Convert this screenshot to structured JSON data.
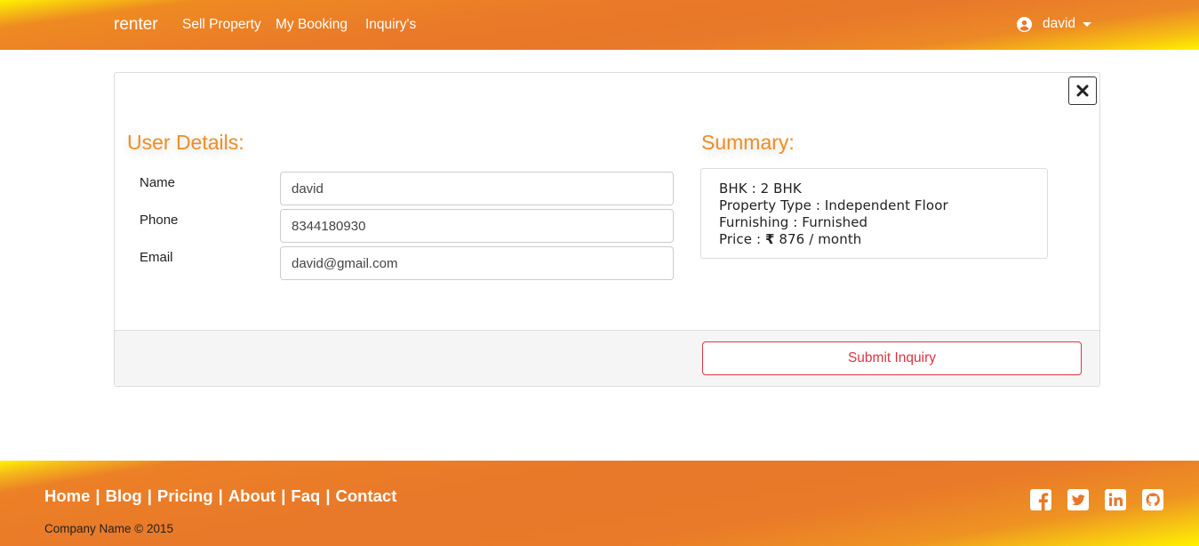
{
  "navbar": {
    "brand": "renter",
    "links": [
      "Sell Property",
      "My Booking",
      "Inquiry's"
    ],
    "user": "david"
  },
  "user_details": {
    "title": "User Details:",
    "fields": [
      {
        "label": "Name",
        "value": "david"
      },
      {
        "label": "Phone",
        "value": "8344180930"
      },
      {
        "label": "Email",
        "value": "david@gmail.com"
      }
    ]
  },
  "summary": {
    "title": "Summary:",
    "bhk": "BHK : 2 BHK",
    "property_type": "Property Type : Independent Floor",
    "furnishing": "Furnishing : Furnished",
    "price_label": "Price : ",
    "price_symbol": "₹",
    "price_value": " 876 / month"
  },
  "actions": {
    "submit": "Submit Inquiry"
  },
  "footer": {
    "links": [
      "Home",
      "Blog",
      "Pricing",
      "About",
      "Faq",
      "Contact"
    ],
    "separator": "|",
    "copyright": "Company Name © 2015",
    "social_icons": [
      "facebook-icon",
      "twitter-icon",
      "linkedin-icon",
      "github-icon"
    ]
  },
  "colors": {
    "accent": "#e8782a",
    "title": "#ee8f22",
    "danger": "#dc3545",
    "highlight": "#fff200"
  }
}
